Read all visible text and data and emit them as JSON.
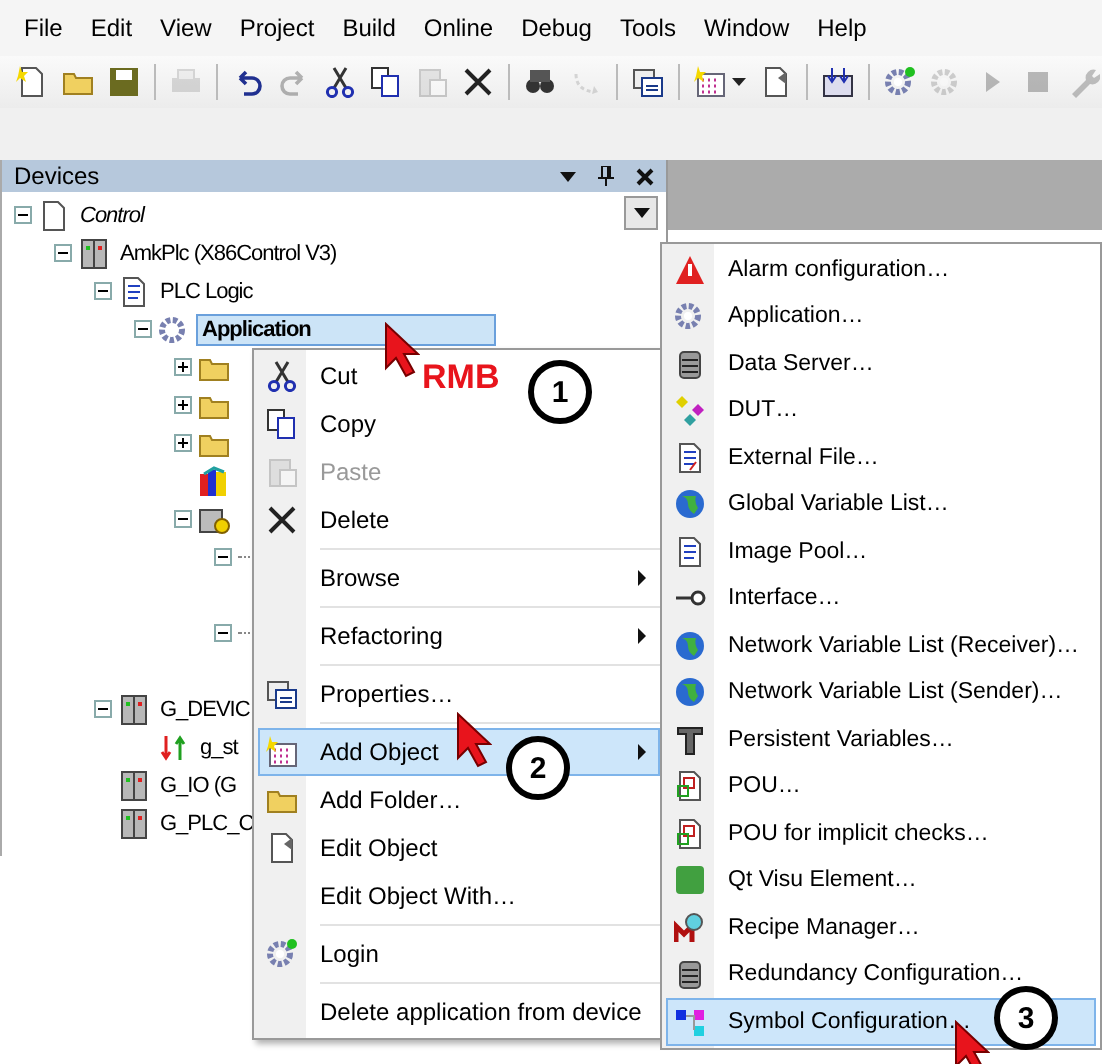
{
  "menu_bar": [
    "File",
    "Edit",
    "View",
    "Project",
    "Build",
    "Online",
    "Debug",
    "Tools",
    "Window",
    "Help"
  ],
  "toolbar": [
    [
      {
        "disabled": false
      },
      {
        "disabled": false
      },
      {
        "disabled": false
      }
    ],
    [
      {
        "disabled": true
      }
    ],
    [
      {
        "disabled": false
      },
      {
        "disabled": true
      },
      {
        "disabled": false
      },
      {
        "disabled": false
      },
      {
        "disabled": true
      },
      {
        "disabled": false
      }
    ],
    [
      {
        "disabled": false
      },
      {
        "disabled": true
      }
    ],
    [
      {
        "disabled": false
      }
    ],
    [
      {
        "disabled": false
      },
      {
        "disabled": false
      }
    ],
    [
      {
        "disabled": false
      }
    ],
    [
      {
        "disabled": false
      },
      {
        "disabled": true
      },
      {
        "disabled": true
      },
      {
        "disabled": true
      },
      {
        "disabled": true
      }
    ]
  ],
  "devices_panel": {
    "title": "Devices",
    "tree": [
      {
        "label": "Control",
        "kind": "control",
        "expanded": true,
        "selected": false,
        "children": [
          {
            "label": "AmkPlc (X86Control V3)",
            "kind": "device",
            "expanded": true,
            "selected": false,
            "children": [
              {
                "label": "PLC Logic",
                "kind": "logic",
                "expanded": true,
                "selected": false,
                "children": [
                  {
                    "label": "Application",
                    "kind": "application",
                    "expanded": true,
                    "selected": true,
                    "children": [
                      {
                        "kind": "folder",
                        "expanded": false
                      },
                      {
                        "kind": "folder",
                        "expanded": false
                      },
                      {
                        "kind": "folder",
                        "expanded": false
                      },
                      {
                        "kind": "library"
                      },
                      {
                        "kind": "task",
                        "expanded": true,
                        "children": [
                          {
                            "kind": "leaf",
                            "expanded": true
                          },
                          {
                            "kind": "leaf",
                            "expanded": true
                          }
                        ]
                      }
                    ]
                  }
                ]
              },
              {
                "label": "G_DEVIC",
                "kind": "device",
                "expanded": true,
                "selected": false,
                "children": [
                  {
                    "label": "g_st",
                    "kind": "io",
                    "selected": false
                  }
                ]
              },
              {
                "label": "G_IO (G",
                "kind": "device",
                "selected": false
              },
              {
                "label": "G_PLC_C",
                "kind": "device",
                "selected": false
              }
            ]
          }
        ]
      }
    ]
  },
  "context_menu": {
    "items": [
      {
        "label": "Cut",
        "kind": "item",
        "divider": false,
        "disabled": false,
        "selected": false
      },
      {
        "label": "Copy",
        "kind": "item",
        "divider": false,
        "disabled": false,
        "selected": false
      },
      {
        "label": "Paste",
        "kind": "item",
        "divider": false,
        "disabled": true,
        "selected": false
      },
      {
        "label": "Delete",
        "kind": "item",
        "divider": false,
        "disabled": false,
        "selected": false
      },
      {
        "label": "Browse",
        "kind": "submenu",
        "divider": true,
        "disabled": false,
        "selected": false
      },
      {
        "label": "Refactoring",
        "kind": "submenu",
        "divider": true,
        "disabled": false,
        "selected": false
      },
      {
        "label": "Properties…",
        "kind": "item",
        "divider": true,
        "disabled": false,
        "selected": false
      },
      {
        "label": "Add Object",
        "kind": "submenu",
        "divider": true,
        "disabled": false,
        "selected": true
      },
      {
        "label": "Add Folder…",
        "kind": "item",
        "divider": false,
        "disabled": false,
        "selected": false
      },
      {
        "label": "Edit Object",
        "kind": "item",
        "divider": false,
        "disabled": false,
        "selected": false
      },
      {
        "label": "Edit Object With…",
        "kind": "item",
        "divider": false,
        "disabled": false,
        "selected": false
      },
      {
        "label": "Login",
        "kind": "item",
        "divider": true,
        "disabled": false,
        "selected": false
      },
      {
        "label": "Delete application from device",
        "kind": "item",
        "divider": true,
        "disabled": false,
        "selected": false
      }
    ]
  },
  "add_object_menu": {
    "items": [
      {
        "label": "Alarm configuration…",
        "selected": false
      },
      {
        "label": "Application…",
        "selected": false
      },
      {
        "label": "Data Server…",
        "selected": false
      },
      {
        "label": "DUT…",
        "selected": false
      },
      {
        "label": "External File…",
        "selected": false
      },
      {
        "label": "Global Variable List…",
        "selected": false
      },
      {
        "label": "Image Pool…",
        "selected": false
      },
      {
        "label": "Interface…",
        "selected": false
      },
      {
        "label": "Network Variable List (Receiver)…",
        "selected": false
      },
      {
        "label": "Network Variable List (Sender)…",
        "selected": false
      },
      {
        "label": "Persistent Variables…",
        "selected": false
      },
      {
        "label": "POU…",
        "selected": false
      },
      {
        "label": "POU for implicit checks…",
        "selected": false
      },
      {
        "label": "Qt Visu Element…",
        "selected": false
      },
      {
        "label": "Recipe Manager…",
        "selected": false
      },
      {
        "label": "Redundancy Configuration…",
        "selected": false
      },
      {
        "label": "Symbol Configuration…",
        "selected": true
      }
    ]
  },
  "annotations": {
    "note": "RMB",
    "callouts": [
      "1",
      "2",
      "3"
    ]
  }
}
